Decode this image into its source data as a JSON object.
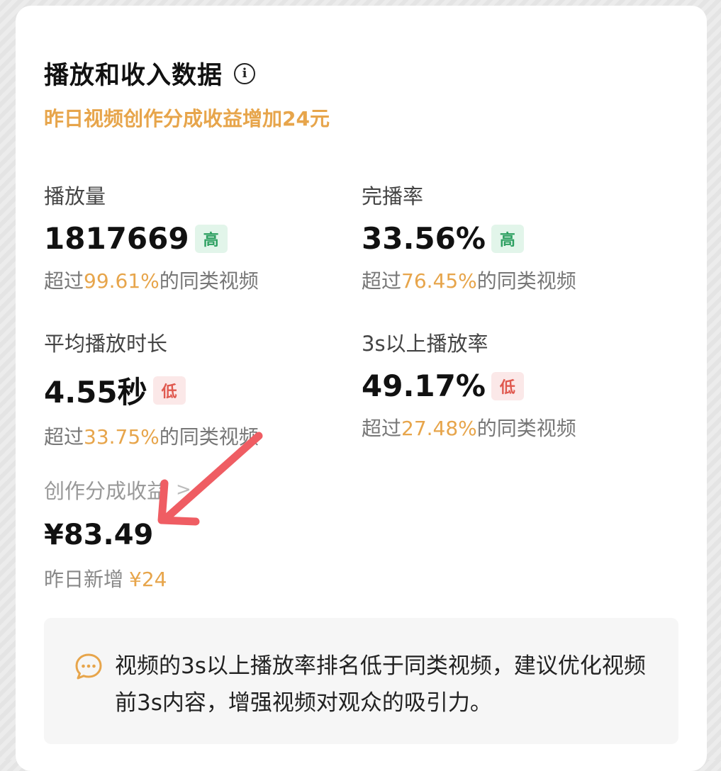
{
  "header": {
    "title": "播放和收入数据",
    "info_icon": "info-icon"
  },
  "subtitle": "昨日视频创作分成收益增加24元",
  "metrics": [
    {
      "label": "播放量",
      "value": "1817669",
      "badge": "高",
      "badge_level": "high",
      "sub_prefix": "超过",
      "sub_pct": "99.61%",
      "sub_suffix": "的同类视频"
    },
    {
      "label": "完播率",
      "value": "33.56%",
      "badge": "高",
      "badge_level": "high",
      "sub_prefix": "超过",
      "sub_pct": "76.45%",
      "sub_suffix": "的同类视频"
    },
    {
      "label": "平均播放时长",
      "value": "4.55秒",
      "badge": "低",
      "badge_level": "low",
      "sub_prefix": "超过",
      "sub_pct": "33.75%",
      "sub_suffix": "的同类视频"
    },
    {
      "label": "3s以上播放率",
      "value": "49.17%",
      "badge": "低",
      "badge_level": "low",
      "sub_prefix": "超过",
      "sub_pct": "27.48%",
      "sub_suffix": "的同类视频"
    }
  ],
  "revenue": {
    "label": "创作分成收益",
    "chevron": ">",
    "value": "¥83.49",
    "sub_label": "昨日新增",
    "sub_amount": "¥24"
  },
  "tip": {
    "icon": "chat-bubble-icon",
    "text": "视频的3s以上播放率排名低于同类视频，建议优化视频前3s内容，增强视频对观众的吸引力。"
  },
  "colors": {
    "accent_orange": "#e7a54b",
    "high_green": "#2ea062",
    "low_red": "#e0594f",
    "arrow_red": "#ef5d63"
  }
}
